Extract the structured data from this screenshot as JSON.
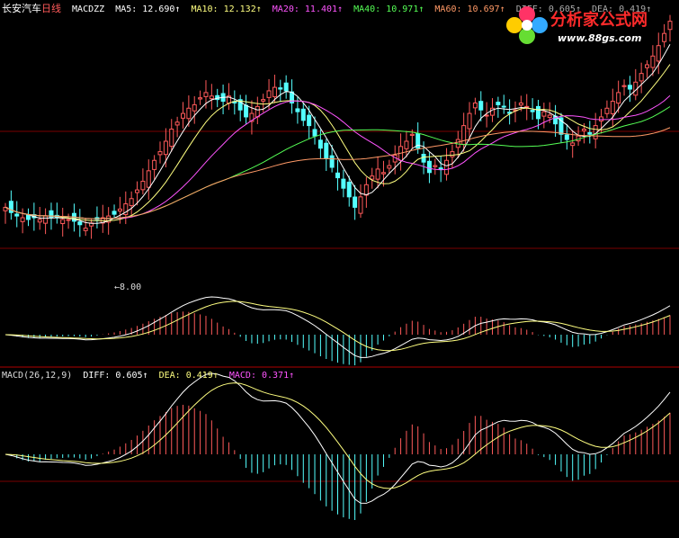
{
  "header": {
    "stock_name": "长安汽车",
    "period": "日线",
    "indicator": "MACDZZ",
    "ma5": "MA5: 12.690↑",
    "ma10": "MA10: 12.132↑",
    "ma20": "MA20: 11.401↑",
    "ma40": "MA40: 10.971↑",
    "ma60": "MA60: 10.697↑",
    "diff_top": "DIFF: 0.605↑",
    "dea_top": "DEA: 0.419↑"
  },
  "macd_header": {
    "name": "MACD(26,12,9)",
    "diff": "DIFF: 0.605↑",
    "dea": "DEA: 0.419↑",
    "macd": "MACD: 0.371↑"
  },
  "annotations": {
    "low_price": "8.00"
  },
  "logo": {
    "text": "分析家公式网",
    "url": "www.88gs.com"
  },
  "colors": {
    "up": "#ff5a5a",
    "down": "#54ffff",
    "ma5": "#ffffff",
    "ma10": "#ffff80",
    "ma20": "#ff55ff",
    "ma40": "#55ff55",
    "ma60": "#ff9966",
    "macd": "#ff55ff"
  },
  "chart_data": {
    "type": "candlestick",
    "price_close": [
      11.2,
      10.9,
      10.7,
      10.6,
      10.5,
      10.6,
      10.5,
      10.7,
      10.6,
      10.6,
      10.5,
      10.5,
      10.4,
      10.2,
      10.0,
      10.3,
      10.5,
      10.6,
      10.7,
      10.8,
      11.1,
      11.4,
      11.7,
      12.2,
      12.7,
      13.3,
      13.9,
      14.4,
      15.0,
      15.7,
      16.1,
      16.6,
      16.9,
      17.1,
      17.5,
      17.8,
      17.6,
      17.4,
      17.3,
      17.6,
      17.2,
      16.8,
      16.4,
      16.6,
      17.0,
      17.4,
      17.9,
      18.1,
      18.0,
      17.9,
      17.2,
      16.7,
      16.2,
      15.9,
      15.3,
      14.6,
      14.0,
      13.5,
      12.9,
      12.3,
      11.8,
      11.2,
      11.8,
      12.5,
      13.0,
      13.4,
      13.2,
      13.6,
      14.2,
      14.7,
      15.0,
      15.4,
      14.6,
      13.8,
      13.2,
      13.6,
      13.4,
      13.9,
      14.4,
      15.1,
      15.9,
      16.6,
      17.2,
      16.8,
      16.5,
      16.9,
      17.1,
      17.0,
      16.6,
      16.8,
      17.2,
      17.0,
      16.7,
      16.3,
      16.7,
      16.5,
      16.0,
      15.4,
      15.1,
      14.9,
      15.3,
      15.7,
      15.4,
      15.9,
      16.4,
      16.9,
      17.3,
      17.8,
      18.2,
      18.0,
      18.4,
      18.9,
      19.4,
      19.9,
      20.5,
      21.2,
      21.9
    ],
    "ma_series": [
      "MA5",
      "MA10",
      "MA20",
      "MA40",
      "MA60"
    ],
    "low_annotation": 8.0,
    "last_values": {
      "MA5": 12.69,
      "MA10": 12.132,
      "MA20": 11.401,
      "MA40": 10.971,
      "MA60": 10.697,
      "DIFF": 0.605,
      "DEA": 0.419,
      "MACD": 0.371
    }
  }
}
